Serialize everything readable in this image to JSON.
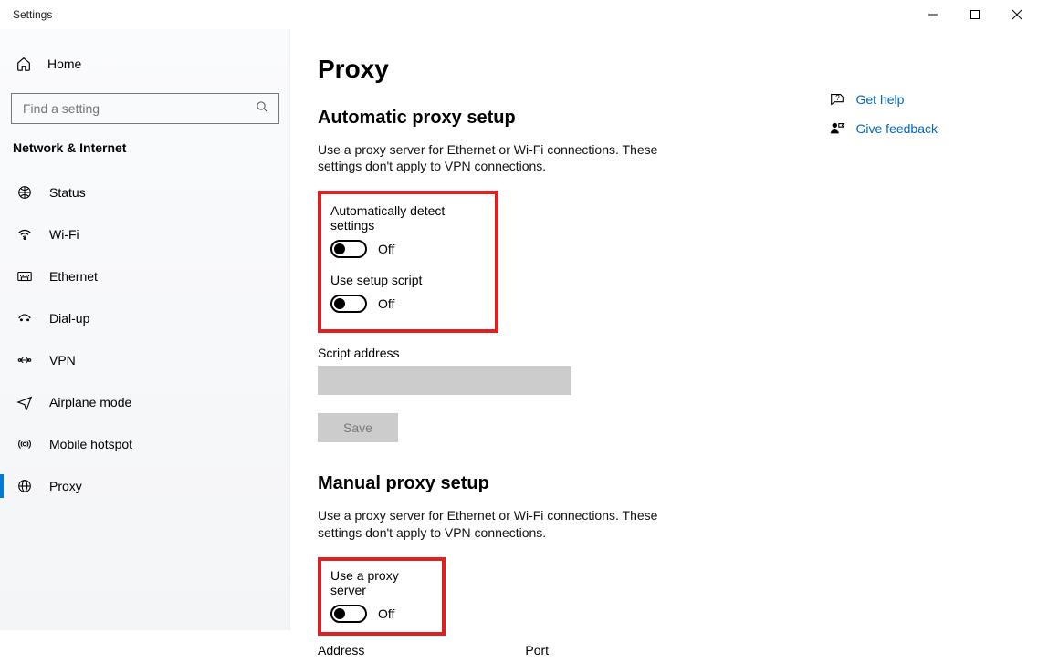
{
  "window": {
    "title": "Settings"
  },
  "sidebar": {
    "home": "Home",
    "search_placeholder": "Find a setting",
    "category": "Network & Internet",
    "items": [
      {
        "label": "Status"
      },
      {
        "label": "Wi-Fi"
      },
      {
        "label": "Ethernet"
      },
      {
        "label": "Dial-up"
      },
      {
        "label": "VPN"
      },
      {
        "label": "Airplane mode"
      },
      {
        "label": "Mobile hotspot"
      },
      {
        "label": "Proxy"
      }
    ]
  },
  "page": {
    "title": "Proxy",
    "auto": {
      "heading": "Automatic proxy setup",
      "desc": "Use a proxy server for Ethernet or Wi-Fi connections. These settings don't apply to VPN connections.",
      "detect_label": "Automatically detect settings",
      "detect_state": "Off",
      "script_label": "Use setup script",
      "script_state": "Off",
      "script_addr_label": "Script address",
      "script_addr_value": "",
      "save": "Save"
    },
    "manual": {
      "heading": "Manual proxy setup",
      "desc": "Use a proxy server for Ethernet or Wi-Fi connections. These settings don't apply to VPN connections.",
      "use_label": "Use a proxy server",
      "use_state": "Off",
      "address_label": "Address",
      "port_label": "Port"
    }
  },
  "help": {
    "get_help": "Get help",
    "feedback": "Give feedback"
  }
}
